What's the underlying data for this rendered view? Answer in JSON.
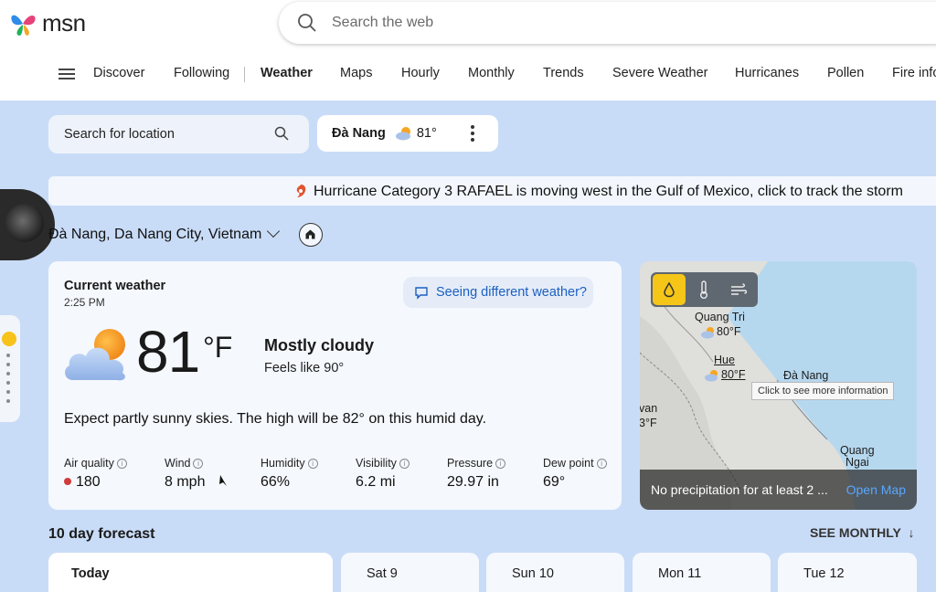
{
  "header": {
    "logo_text": "msn",
    "search": {
      "placeholder": "Search the web"
    }
  },
  "nav": {
    "items": [
      "Discover",
      "Following",
      "Weather",
      "Maps",
      "Hourly",
      "Monthly",
      "Trends",
      "Severe Weather",
      "Hurricanes",
      "Pollen",
      "Fire info"
    ],
    "active": "Weather"
  },
  "location_search": {
    "placeholder": "Search for location"
  },
  "location_chip": {
    "city": "Đà Nang",
    "temp": "81°"
  },
  "banner": {
    "text": "Hurricane Category 3 RAFAEL is moving west in the Gulf of Mexico, click to track the storm"
  },
  "location_title": "Đà Nang, Da Nang City, Vietnam",
  "current": {
    "title": "Current weather",
    "time": "2:25 PM",
    "feedback_label": "Seeing different weather?",
    "temp": "81",
    "unit": "°F",
    "condition": "Mostly cloudy",
    "feels_like": "Feels like  90°",
    "summary": "Expect partly sunny skies. The high will be 82° on this humid day.",
    "metrics": [
      {
        "label": "Air quality",
        "value": "180"
      },
      {
        "label": "Wind",
        "value": "8 mph"
      },
      {
        "label": "Humidity",
        "value": "66%"
      },
      {
        "label": "Visibility",
        "value": "6.2 mi"
      },
      {
        "label": "Pressure",
        "value": "29.97 in"
      },
      {
        "label": "Dew point",
        "value": "69°"
      }
    ]
  },
  "map": {
    "labels": {
      "quang_tri": "Quang Tri",
      "quang_tri_temp": "80°F",
      "hue": "Hue",
      "hue_temp": "80°F",
      "da_nang": "Đà Nang",
      "van": "van",
      "van_temp": "3°F",
      "quang_ngai_1": "Quang",
      "quang_ngai_2": "Ngai"
    },
    "tooltip": "Click to see more information",
    "footer_msg": "No precipitation for at least 2 ...",
    "open_label": "Open Map"
  },
  "forecast": {
    "title": "10 day forecast",
    "see_monthly": "SEE MONTHLY",
    "days": [
      "Today",
      "Sat 9",
      "Sun 10",
      "Mon 11",
      "Tue 12"
    ]
  },
  "colors": {
    "background": "#c9dcf7",
    "link": "#1b5fc1",
    "map_tool_active": "#f5c518",
    "air_quality_dot": "#d13b3b"
  }
}
